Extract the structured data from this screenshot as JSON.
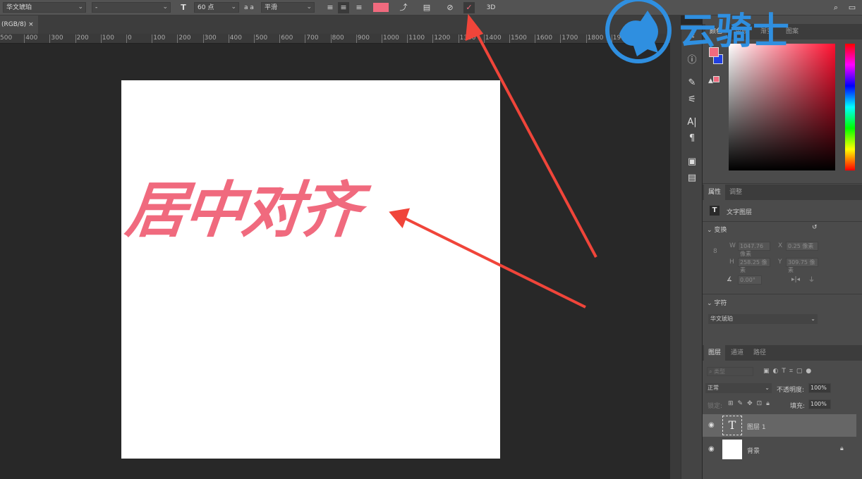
{
  "toolbar": {
    "font_family": "华文琥珀",
    "font_style": "-",
    "font_size": "60 点",
    "aa_label": "a a",
    "antialias": "平滑",
    "text_color": "#f06a7e",
    "three_d": "3D"
  },
  "document_tab": {
    "title": "(RGB/8)",
    "close": "×"
  },
  "ruler": {
    "labels": [
      "500",
      "400",
      "300",
      "200",
      "100",
      "0",
      "100",
      "200",
      "300",
      "400",
      "500",
      "600",
      "700",
      "800",
      "900",
      "1000",
      "1100",
      "1200",
      "1300",
      "1400",
      "1500",
      "1600",
      "1700",
      "1800",
      "1900"
    ]
  },
  "canvas": {
    "text": "居中对齐",
    "text_color": "#f06a7e"
  },
  "color_panel": {
    "tabs": [
      "颜色",
      "色板",
      "渐变",
      "图案"
    ],
    "foreground": "#f06a7e",
    "background": "#2040e0"
  },
  "properties": {
    "tabs": [
      "属性",
      "调整"
    ],
    "layer_type": "文字图层",
    "transform": {
      "title": "变换",
      "w_label": "W",
      "w": "1047.76 像素",
      "x_label": "X",
      "x": "0.25 像素",
      "h_label": "H",
      "h": "258.25 像素",
      "y_label": "Y",
      "y": "309.75 像素",
      "angle": "0.00°"
    },
    "character": {
      "title": "字符",
      "font": "华文琥珀"
    }
  },
  "layers": {
    "tabs": [
      "图层",
      "通道",
      "路径"
    ],
    "filter_placeholder": "类型",
    "blend_mode": "正常",
    "opacity_label": "不透明度:",
    "opacity": "100%",
    "lock_label": "锁定:",
    "fill_label": "填充:",
    "fill": "100%",
    "items": [
      {
        "name": "图层 1",
        "type": "text",
        "selected": true
      },
      {
        "name": "背景",
        "type": "background",
        "locked": true
      }
    ]
  },
  "watermark": {
    "text": "云骑士",
    "color": "#2f8fe0"
  },
  "annotation_color": "#f0453a"
}
